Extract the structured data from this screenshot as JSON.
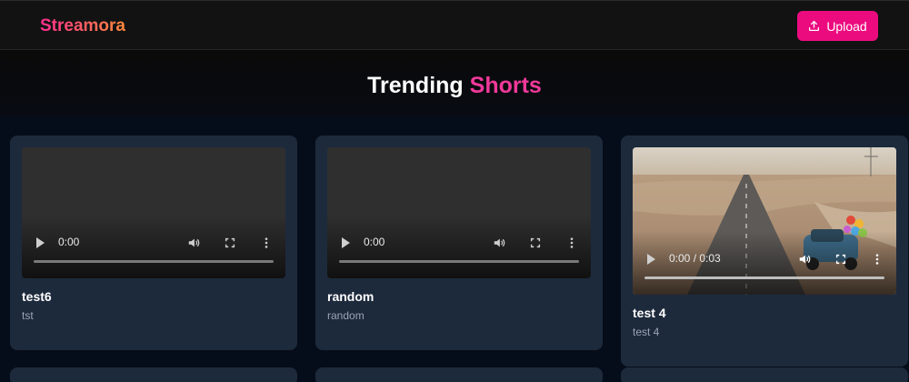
{
  "app": {
    "brand": "Streamora",
    "upload_label": "Upload"
  },
  "hero": {
    "title_main": "Trending",
    "title_accent": "Shorts"
  },
  "colors": {
    "brand_gradient_start": "#ff2e8f",
    "brand_gradient_end": "#ff8a3c",
    "accent_pink": "#ec0b7f",
    "card_bg": "#1d2a3c"
  },
  "videos": [
    {
      "title": "test6",
      "description": "tst",
      "time": "0:00",
      "progress": 0
    },
    {
      "title": "random",
      "description": "random",
      "time": "0:00",
      "progress": 0
    },
    {
      "title": "test 4",
      "description": "test 4",
      "time": "0:00 / 0:03",
      "progress": 0
    }
  ],
  "icons": {
    "play": "play-icon",
    "volume": "volume-icon",
    "fullscreen": "fullscreen-icon",
    "more": "more-vertical-icon",
    "upload": "upload-icon"
  }
}
